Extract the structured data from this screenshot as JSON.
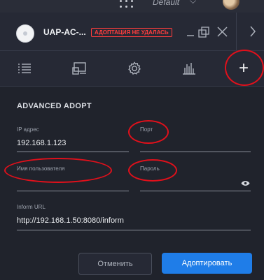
{
  "topbar": {
    "site_name": "Default",
    "chevron": "⌵"
  },
  "header": {
    "device_name": "UAP-AC-...",
    "status_badge": "АДОПТАЦИЯ НЕ УДАЛАСЬ",
    "icons": [
      "minimize-icon",
      "popout-icon",
      "close-icon",
      "next-icon"
    ]
  },
  "tabs": [
    {
      "name": "details",
      "icon": "list-icon"
    },
    {
      "name": "devices",
      "icon": "devices-icon"
    },
    {
      "name": "settings",
      "icon": "gear-icon"
    },
    {
      "name": "statistics",
      "icon": "bar-chart-icon"
    },
    {
      "name": "add",
      "icon": "plus-icon",
      "glyph": "+",
      "active": true
    }
  ],
  "form": {
    "section_title": "ADVANCED ADOPT",
    "ip_label": "IP адрес",
    "ip_value": "192.168.1.123",
    "port_label": "Порт",
    "port_value": "",
    "username_label": "Имя пользователя",
    "username_value": "",
    "password_label": "Пароль",
    "password_value": "",
    "inform_label": "Inform URL",
    "inform_value": "http://192.168.1.50:8080/inform"
  },
  "buttons": {
    "cancel": "Отменить",
    "adopt": "Адоптировать"
  },
  "colors": {
    "background": "#20232c",
    "primary": "#1f7de8",
    "error": "#ff3d3d",
    "annotation": "#e1101b"
  }
}
